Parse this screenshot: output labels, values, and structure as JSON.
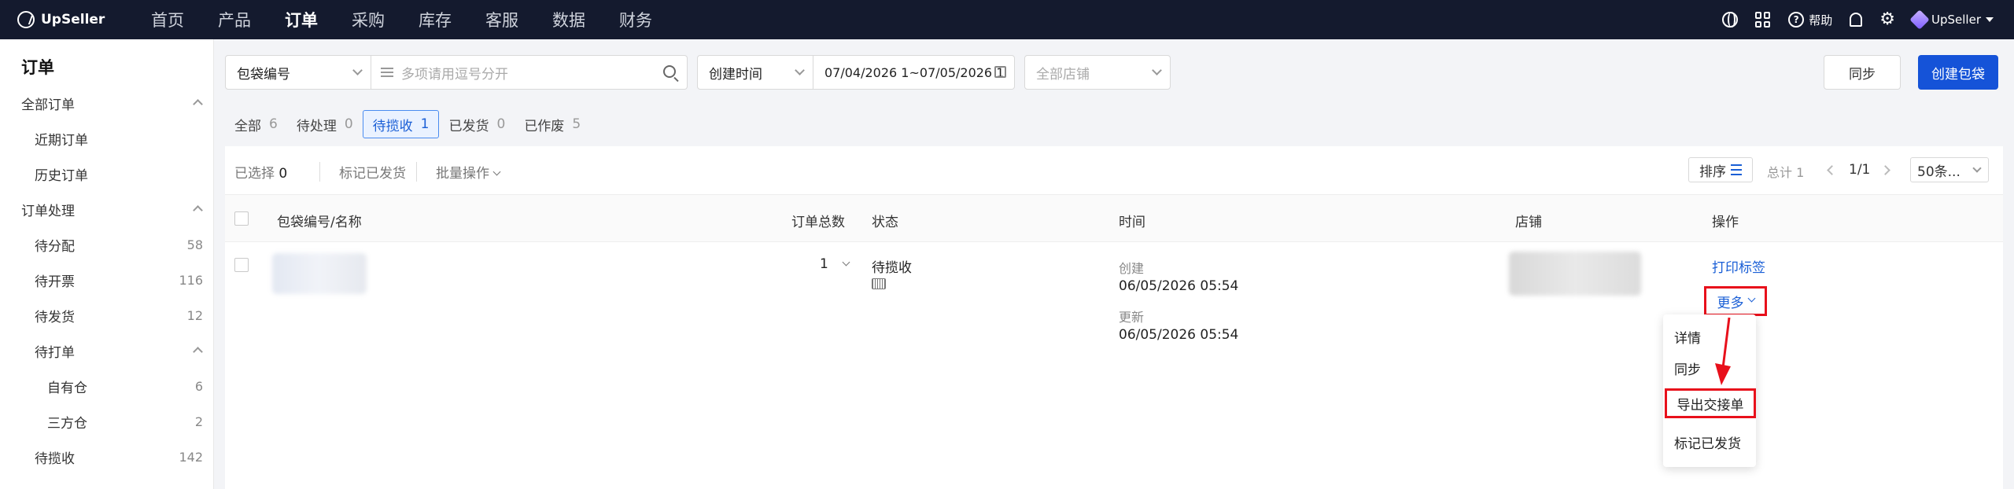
{
  "app": {
    "logo": "UpSeller",
    "nav": [
      "首页",
      "产品",
      "订单",
      "采购",
      "库存",
      "客服",
      "数据",
      "财务"
    ],
    "active_nav": "订单",
    "help_label": "帮助",
    "account_label": "UpSeller"
  },
  "sidebar": {
    "title": "订单",
    "items": [
      {
        "label": "全部订单",
        "count": ""
      },
      {
        "label": "近期订单",
        "count": ""
      },
      {
        "label": "历史订单",
        "count": ""
      },
      {
        "label": "订单处理",
        "count": ""
      },
      {
        "label": "待分配",
        "count": "58"
      },
      {
        "label": "待开票",
        "count": "116"
      },
      {
        "label": "待发货",
        "count": "12"
      },
      {
        "label": "待打单",
        "count": ""
      },
      {
        "label": "自有仓",
        "count": "6"
      },
      {
        "label": "三方仓",
        "count": "2"
      },
      {
        "label": "待揽收",
        "count": "142"
      }
    ]
  },
  "filters": {
    "type_select": "包袋编号",
    "search_placeholder": "多项请用逗号分开",
    "time_select": "创建时间",
    "date_range": "07/04/2026 1~07/05/2026 1",
    "store_placeholder": "全部店铺"
  },
  "actions": {
    "sync": "同步",
    "create": "创建包袋"
  },
  "tabs": [
    {
      "label": "全部",
      "count": "6"
    },
    {
      "label": "待处理",
      "count": "0"
    },
    {
      "label": "待揽收",
      "count": "1"
    },
    {
      "label": "已发货",
      "count": "0"
    },
    {
      "label": "已作废",
      "count": "5"
    }
  ],
  "toolbar": {
    "selected_label": "已选择",
    "selected_count": "0",
    "mark_shipped": "标记已发货",
    "bulk_ops": "批量操作",
    "sort": "排序",
    "total": "总计 1",
    "page": "1/1",
    "page_size": "50条..."
  },
  "table": {
    "headers": {
      "name": "包袋编号/名称",
      "order_total": "订单总数",
      "status": "状态",
      "time": "时间",
      "store": "店铺",
      "ops": "操作"
    },
    "row": {
      "order_total": "1",
      "status": "待揽收",
      "created_label": "创建",
      "created": "06/05/2026 05:54",
      "updated_label": "更新",
      "updated": "06/05/2026 05:54",
      "print_label": "打印标签",
      "more": "更多"
    }
  },
  "dropdown": [
    "详情",
    "同步",
    "导出交接单",
    "标记已发货"
  ]
}
